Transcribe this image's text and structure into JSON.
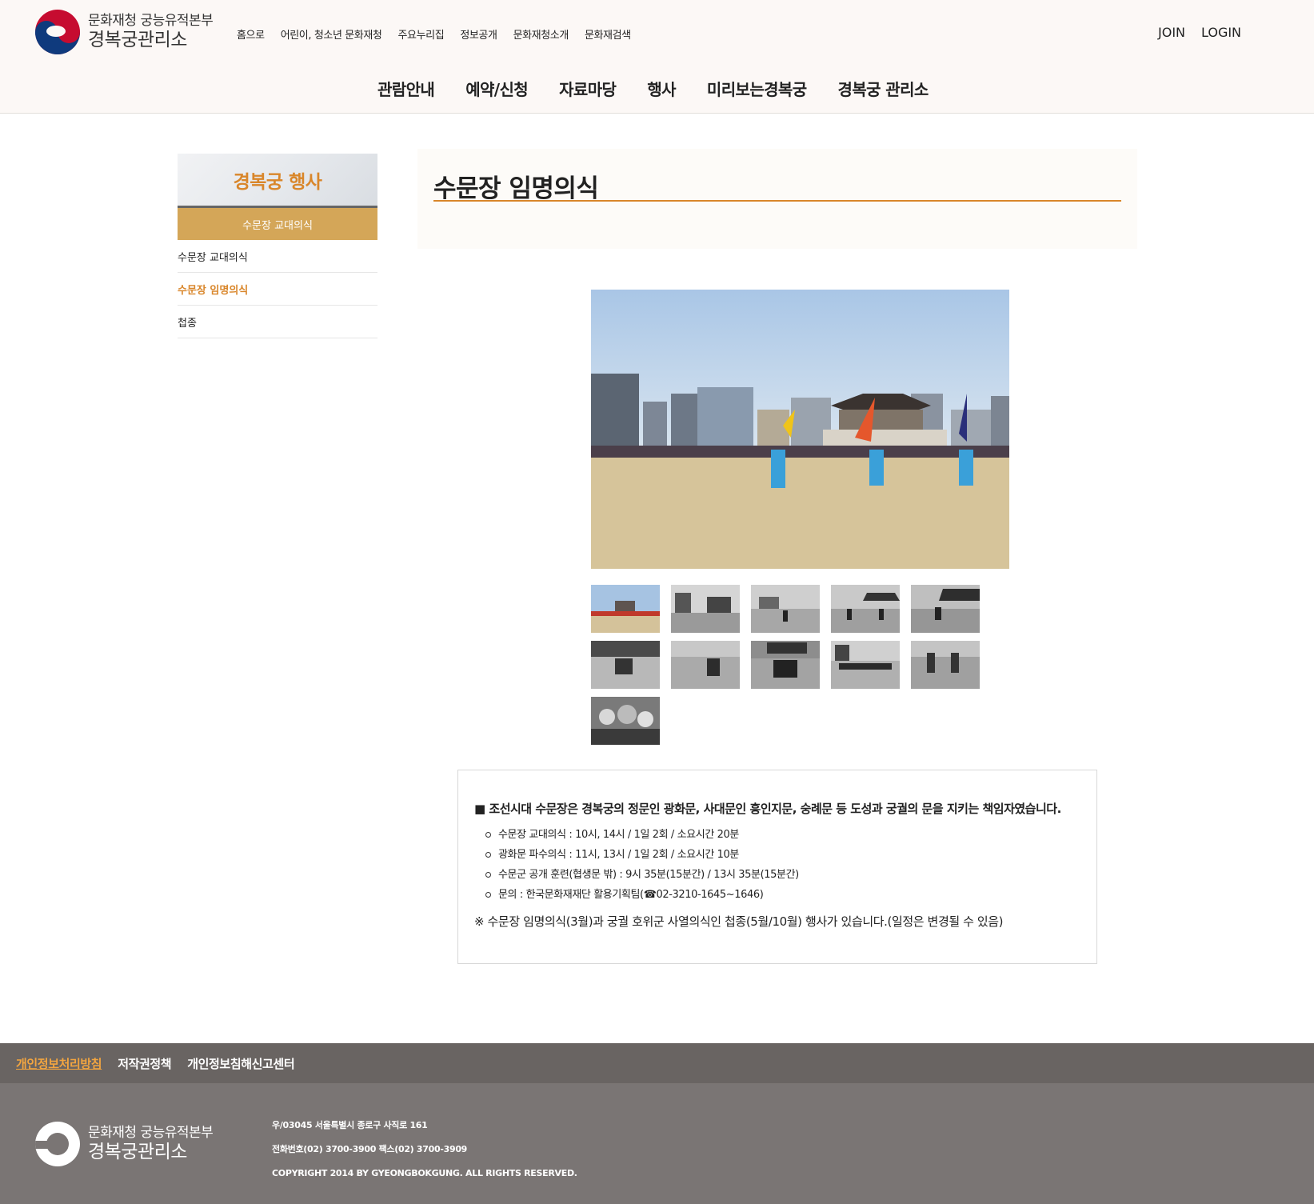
{
  "header": {
    "org_sub": "문화재청 궁능유적본부",
    "org_main": "경복궁관리소",
    "util_nav": [
      "홈으로",
      "어린이, 청소년 문화재청",
      "주요누리집",
      "정보공개",
      "문화재청소개",
      "문화재검색"
    ],
    "auth": {
      "join": "JOIN",
      "login": "LOGIN"
    },
    "gnb": [
      "관람안내",
      "예약/신청",
      "자료마당",
      "행사",
      "미리보는경복궁",
      "경복궁 관리소"
    ]
  },
  "sidebar": {
    "title": "경복궁 행사",
    "active_label": "수문장 교대의식",
    "items": [
      {
        "label": "수문장 교대의식"
      },
      {
        "label": "수문장 임명의식"
      },
      {
        "label": "첩종"
      }
    ]
  },
  "content": {
    "title": "수문장 임명의식"
  },
  "gallery": {
    "main_alt": "photo",
    "thumb_count": 11
  },
  "info": {
    "lead": "■ 조선시대 수문장은 경복궁의 정문인 광화문, 사대문인 흥인지문, 숭례문 등 도성과 궁궐의 문을 지키는 책임자였습니다.",
    "items": [
      "수문장 교대의식 : 10시, 14시 / 1일 2회 / 소요시간 20분",
      "광화문 파수의식 : 11시, 13시 / 1일 2회 / 소요시간 10분",
      "수문군 공개 훈련(협생문 밖) : 9시 35분(15분간) / 13시 35분(15분간)",
      "문의 : 한국문화재재단 활용기획팀(☎02-3210-1645~1646)"
    ],
    "note": "※ 수문장 임명의식(3월)과 궁궐 호위군 사열의식인 첩종(5월/10월) 행사가 있습니다.(일정은 변경될 수 있음)"
  },
  "footer": {
    "links": {
      "privacy": "개인정보처리방침",
      "copyright": "저작권정책",
      "report": "개인정보침해신고센터"
    },
    "org_sub": "문화재청 궁능유적본부",
    "org_main": "경복궁관리소",
    "address": "우/03045 서울특별시 종로구 사직로 161",
    "phone": "전화번호(02) 3700-3900 팩스(02) 3700-3909",
    "copyright": "COPYRIGHT 2014 BY GYEONGBOKGUNG. ALL RIGHTS RESERVED."
  },
  "colors": {
    "accent": "#d9862a",
    "sidebar_active": "#d4a658",
    "footer": "#7a7574",
    "footer_links": "#696462"
  }
}
